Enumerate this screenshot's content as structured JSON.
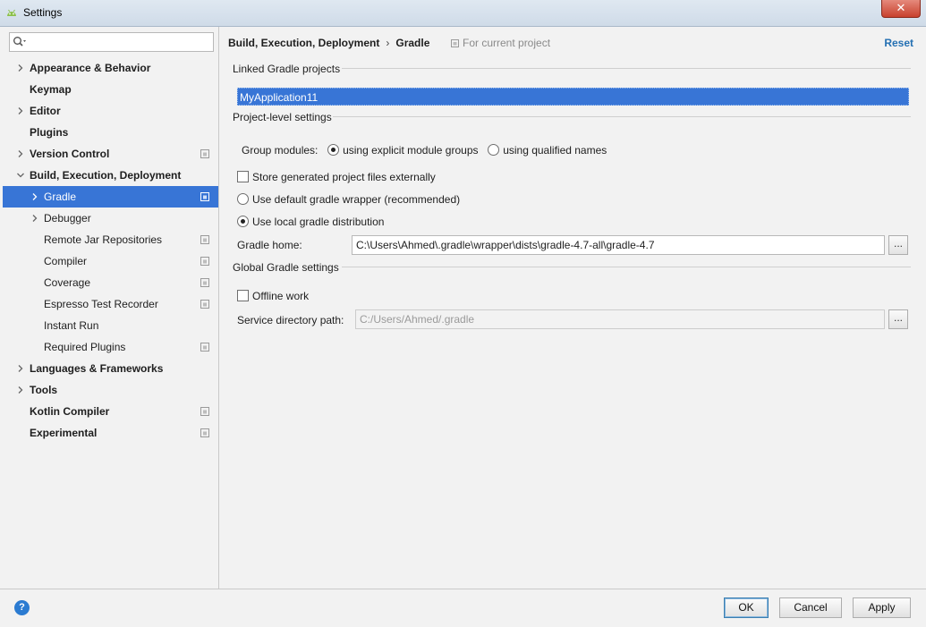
{
  "window": {
    "title": "Settings",
    "close_label": "✕"
  },
  "sidebar": {
    "search_value": "",
    "items": [
      {
        "label": "Appearance & Behavior",
        "expandable": true,
        "expanded": false,
        "bold": true,
        "level": 0,
        "project_icon": false
      },
      {
        "label": "Keymap",
        "expandable": false,
        "bold": true,
        "level": 0,
        "project_icon": false
      },
      {
        "label": "Editor",
        "expandable": true,
        "expanded": false,
        "bold": true,
        "level": 0,
        "project_icon": false
      },
      {
        "label": "Plugins",
        "expandable": false,
        "bold": true,
        "level": 0,
        "project_icon": false
      },
      {
        "label": "Version Control",
        "expandable": true,
        "expanded": false,
        "bold": true,
        "level": 0,
        "project_icon": true
      },
      {
        "label": "Build, Execution, Deployment",
        "expandable": true,
        "expanded": true,
        "bold": true,
        "level": 0,
        "project_icon": false
      },
      {
        "label": "Gradle",
        "expandable": true,
        "expanded": false,
        "bold": false,
        "level": 1,
        "project_icon": true,
        "selected": true
      },
      {
        "label": "Debugger",
        "expandable": true,
        "expanded": false,
        "bold": false,
        "level": 1,
        "project_icon": false
      },
      {
        "label": "Remote Jar Repositories",
        "expandable": false,
        "bold": false,
        "level": 1,
        "project_icon": true
      },
      {
        "label": "Compiler",
        "expandable": false,
        "bold": false,
        "level": 1,
        "project_icon": true
      },
      {
        "label": "Coverage",
        "expandable": false,
        "bold": false,
        "level": 1,
        "project_icon": true
      },
      {
        "label": "Espresso Test Recorder",
        "expandable": false,
        "bold": false,
        "level": 1,
        "project_icon": true
      },
      {
        "label": "Instant Run",
        "expandable": false,
        "bold": false,
        "level": 1,
        "project_icon": false
      },
      {
        "label": "Required Plugins",
        "expandable": false,
        "bold": false,
        "level": 1,
        "project_icon": true
      },
      {
        "label": "Languages & Frameworks",
        "expandable": true,
        "expanded": false,
        "bold": true,
        "level": 0,
        "project_icon": false
      },
      {
        "label": "Tools",
        "expandable": true,
        "expanded": false,
        "bold": true,
        "level": 0,
        "project_icon": false
      },
      {
        "label": "Kotlin Compiler",
        "expandable": false,
        "bold": true,
        "level": 0,
        "project_icon": true
      },
      {
        "label": "Experimental",
        "expandable": false,
        "bold": true,
        "level": 0,
        "project_icon": true
      }
    ]
  },
  "header": {
    "breadcrumb_parent": "Build, Execution, Deployment",
    "breadcrumb_sep": "›",
    "breadcrumb_current": "Gradle",
    "for_current_project": "For current project",
    "reset_label": "Reset"
  },
  "linked_projects": {
    "heading": "Linked Gradle projects",
    "items": [
      "MyApplication11"
    ]
  },
  "project_level": {
    "heading": "Project-level settings",
    "group_modules_label": "Group modules:",
    "group_option_explicit": "using explicit module groups",
    "group_option_qualified": "using qualified names",
    "group_selected": "explicit",
    "store_externally_label": "Store generated project files externally",
    "store_externally_checked": false,
    "default_wrapper_label": "Use default gradle wrapper (recommended)",
    "local_distribution_label": "Use local gradle distribution",
    "distribution_selected": "local",
    "gradle_home_label": "Gradle home:",
    "gradle_home_value": "C:\\Users\\Ahmed\\.gradle\\wrapper\\dists\\gradle-4.7-all\\gradle-4.7",
    "browse_label": "..."
  },
  "global": {
    "heading": "Global Gradle settings",
    "offline_label": "Offline work",
    "offline_checked": false,
    "service_dir_label": "Service directory path:",
    "service_dir_value": "C:/Users/Ahmed/.gradle",
    "browse_label": "..."
  },
  "footer": {
    "help_label": "?",
    "ok_label": "OK",
    "cancel_label": "Cancel",
    "apply_label": "Apply"
  },
  "colors": {
    "selection": "#3875d6",
    "link": "#2470b3",
    "help": "#2b7bd1"
  },
  "icons": {
    "app": "android-icon",
    "search": "search-icon",
    "project": "project-scope-icon",
    "expand": "chevron-right-icon",
    "collapse": "chevron-down-icon",
    "help": "help-icon"
  }
}
